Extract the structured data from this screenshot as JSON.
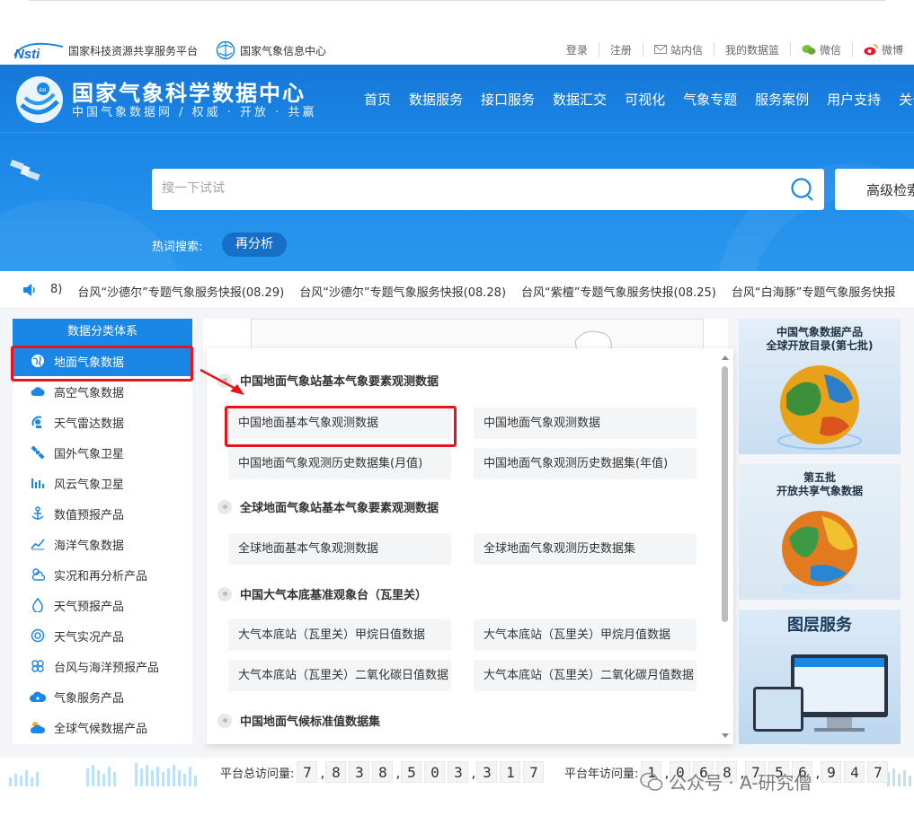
{
  "topbar": {
    "nsti_logo": "Nsti",
    "platform_name": "国家科技资源共享服务平台",
    "center_name": "国家气象信息中心",
    "links": [
      "登录",
      "注册",
      "站内信",
      "我的数据篮",
      "微信",
      "微博"
    ]
  },
  "header": {
    "title": "国家气象科学数据中心",
    "subtitle": "中国气象数据网 / 权威 · 开放 · 共赢",
    "nav": [
      "首页",
      "数据服务",
      "接口服务",
      "数据汇交",
      "可视化",
      "气象专题",
      "服务案例",
      "用户支持",
      "关于"
    ],
    "search_placeholder": "搜一下试试",
    "advanced_search": "高级检索",
    "hot_label": "热词搜索:",
    "hot_tag": "再分析"
  },
  "ticker": {
    "items": [
      "8)",
      "台风“沙德尔”专题气象服务快报(08.29)",
      "台风“沙德尔”专题气象服务快报(08.28)",
      "台风“紫檀”专题气象服务快报(08.25)",
      "台风“白海豚”专题气象服务快报"
    ]
  },
  "sidebar": {
    "heading": "数据分类体系",
    "items": [
      {
        "label": "地面气象数据",
        "icon": "globe-icon"
      },
      {
        "label": "高空气象数据",
        "icon": "cloud-icon"
      },
      {
        "label": "天气雷达数据",
        "icon": "radar-icon"
      },
      {
        "label": "国外气象卫星",
        "icon": "satellite-icon"
      },
      {
        "label": "风云气象卫星",
        "icon": "bar-chart-icon"
      },
      {
        "label": "数值预报产品",
        "icon": "anchor-icon"
      },
      {
        "label": "海洋气象数据",
        "icon": "line-chart-icon"
      },
      {
        "label": "实况和再分析产品",
        "icon": "sun-cloud-icon"
      },
      {
        "label": "天气预报产品",
        "icon": "water-drop-icon"
      },
      {
        "label": "天气实况产品",
        "icon": "target-icon"
      },
      {
        "label": "台风与海洋预报产品",
        "icon": "typhoon-icon"
      },
      {
        "label": "气象服务产品",
        "icon": "service-cloud-icon"
      },
      {
        "label": "全球气候数据产品",
        "icon": "climate-icon"
      }
    ]
  },
  "dropdown": {
    "groups": [
      {
        "title": "中国地面气象站基本气象要素观测数据",
        "cells": [
          "中国地面基本气象观测数据",
          "中国地面气象观测数据",
          "中国地面气象观测历史数据集(月值)",
          "中国地面气象观测历史数据集(年值)"
        ]
      },
      {
        "title": "全球地面气象站基本气象要素观测数据",
        "cells": [
          "全球地面基本气象观测数据",
          "全球地面气象观测历史数据集"
        ]
      },
      {
        "title": "中国大气本底基准观象台（瓦里关）",
        "cells": [
          "大气本底站（瓦里关）甲烷日值数据",
          "大气本底站（瓦里关）甲烷月值数据",
          "大气本底站（瓦里关）二氧化碳日值数据",
          "大气本底站（瓦里关）二氧化碳月值数据"
        ]
      },
      {
        "title": "中国地面气候标准值数据集",
        "cells": []
      }
    ]
  },
  "banners": {
    "b1_line1": "中国气象数据产品",
    "b1_line2": "全球开放目录(第七批)",
    "b2_line1": "第五批",
    "b2_line2": "开放共享气象数据",
    "b3_title": "图层服务"
  },
  "footer": {
    "total_label": "平台总访问量:",
    "total_digits": [
      "7",
      ",",
      "8",
      "3",
      "8",
      ",",
      "5",
      "0",
      "3",
      ",",
      "3",
      "1",
      "7"
    ],
    "year_label": "平台年访问量:",
    "year_digits": [
      "1",
      ",",
      "0",
      "6",
      "8",
      ",",
      "7",
      "5",
      "6",
      ",",
      "9",
      "4",
      "7"
    ]
  },
  "watermark": {
    "text": "公众号 · A-研究僧"
  },
  "colors": {
    "brand_blue": "#1a86e6",
    "highlight_red": "#e8141b"
  }
}
